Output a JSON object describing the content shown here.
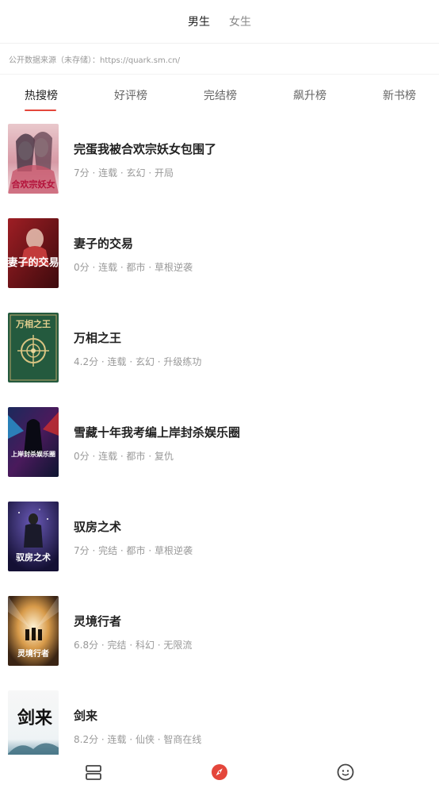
{
  "gender_tabs": [
    {
      "label": "男生",
      "active": true
    },
    {
      "label": "女生",
      "active": false
    }
  ],
  "source_note": "公开数据来源（未存储）：https://quark.sm.cn/",
  "rank_tabs": [
    {
      "label": "热搜榜",
      "active": true
    },
    {
      "label": "好评榜",
      "active": false
    },
    {
      "label": "完结榜",
      "active": false
    },
    {
      "label": "飙升榜",
      "active": false
    },
    {
      "label": "新书榜",
      "active": false
    }
  ],
  "books": [
    {
      "title": "完蛋我被合欢宗妖女包围了",
      "meta": "7分 · 连载 · 玄幻 · 开局",
      "cover_text": "合欢宗妖女"
    },
    {
      "title": "妻子的交易",
      "meta": "0分 · 连载 · 都市 · 草根逆袭",
      "cover_text": "妻子的交易"
    },
    {
      "title": "万相之王",
      "meta": "4.2分 · 连载 · 玄幻 · 升级练功",
      "cover_text": "万相之王"
    },
    {
      "title": "雪藏十年我考编上岸封杀娱乐圈",
      "meta": "0分 · 连载 · 都市 · 复仇",
      "cover_text": "上岸封杀娱乐圈"
    },
    {
      "title": "驭房之术",
      "meta": "7分 · 完结 · 都市 · 草根逆袭",
      "cover_text": "驭房之术"
    },
    {
      "title": "灵境行者",
      "meta": "6.8分 · 完结 · 科幻 · 无限流",
      "cover_text": "灵境行者"
    },
    {
      "title": "剑来",
      "meta": "8.2分 · 连载 · 仙侠 · 智商在线",
      "cover_text": "剑来"
    }
  ],
  "nav": {
    "items": [
      {
        "icon": "bookshelf-icon"
      },
      {
        "icon": "compass-icon",
        "active": true
      },
      {
        "icon": "smiley-icon"
      }
    ],
    "accent": "#e4463b"
  },
  "colors": {
    "accent": "#e4463b",
    "text_primary": "#222222",
    "text_secondary": "#999999"
  }
}
